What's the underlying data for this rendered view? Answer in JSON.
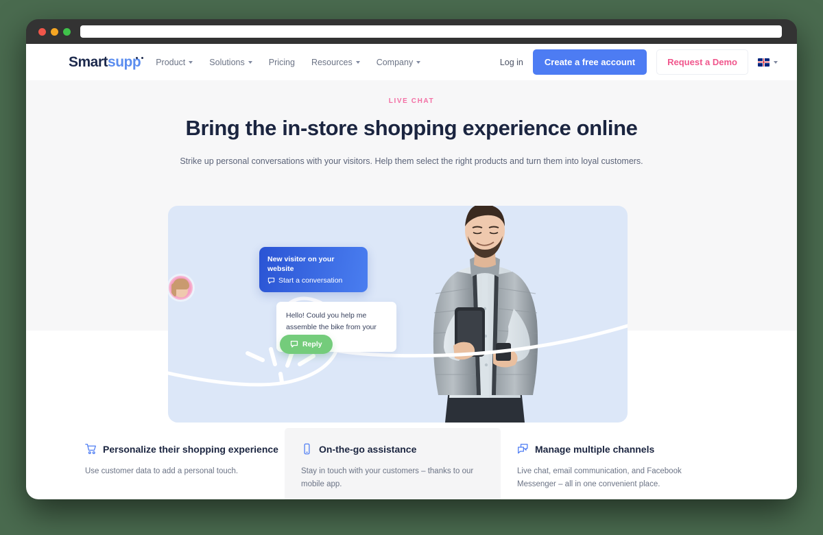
{
  "browser": {
    "url_value": "",
    "url_placeholder": "",
    "traffic_lights": [
      "close",
      "minimize",
      "maximize"
    ]
  },
  "header": {
    "logo": {
      "part1": "Smart",
      "part2": "supp"
    },
    "nav": [
      {
        "label": "Product",
        "has_caret": true
      },
      {
        "label": "Solutions",
        "has_caret": true
      },
      {
        "label": "Pricing",
        "has_caret": false
      },
      {
        "label": "Resources",
        "has_caret": true
      },
      {
        "label": "Company",
        "has_caret": true
      }
    ],
    "login_label": "Log in",
    "primary_cta": "Create a free account",
    "secondary_cta": "Request a Demo",
    "language": {
      "icon": "uk-flag-icon",
      "has_caret": true
    }
  },
  "hero": {
    "eyebrow": "LIVE CHAT",
    "title": "Bring the in-store shopping experience online",
    "subtitle": "Strike up personal conversations with your visitors. Help them select the right products and turn them into loyal customers."
  },
  "chat": {
    "notification": {
      "title": "New visitor on your website",
      "action": "Start a conversation",
      "icon": "chat-bubble-icon"
    },
    "visitor_message": "Hello! Could you help me assemble the bike from your shop?",
    "reply_button": {
      "label": "Reply",
      "icon": "chat-bubble-icon"
    }
  },
  "features": [
    {
      "icon": "shopping-cart-icon",
      "title": "Personalize their shopping experience",
      "body": "Use customer data to add a personal touch.",
      "highlight": false
    },
    {
      "icon": "mobile-phone-icon",
      "title": "On-the-go assistance",
      "body": "Stay in touch with your customers – thanks to our mobile app.",
      "highlight": true
    },
    {
      "icon": "multi-chat-icon",
      "title": "Manage multiple channels",
      "body": "Live chat, email communication, and Facebook Messenger – all in one convenient place.",
      "highlight": false
    }
  ],
  "colors": {
    "brand_blue": "#4d7cf3",
    "brand_pink": "#f0568c",
    "eyebrow_pink": "#f36fa4",
    "reply_green": "#74cc7b",
    "hero_art_bg": "#dce7f8",
    "page_bg_top": "#f7f7f8",
    "desktop_bg": "#4a6b4f",
    "chrome_bg": "#333333",
    "heading_navy": "#1b2540"
  }
}
